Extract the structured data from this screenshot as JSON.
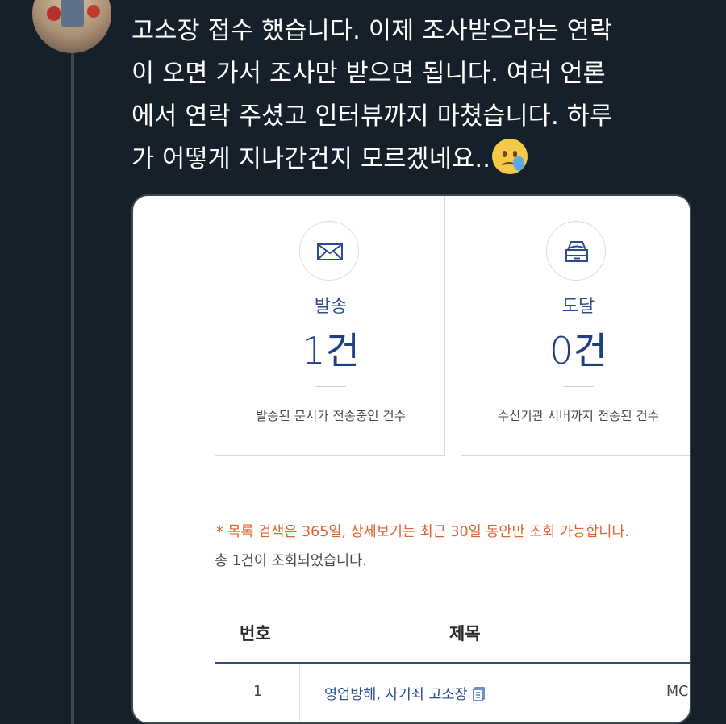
{
  "tweet": {
    "lines": [
      "고소장 접수 했습니다. 이제 조사받으라는 연락",
      "이 오면 가서 조사만 받으면 됩니다. 여러 언론",
      "에서 연락 주셨고 인터뷰까지 마쳤습니다. 하루",
      "가 어떻게 지나간건지 모르겠네요.."
    ],
    "emoji": "crying-face-emoji"
  },
  "screenshot": {
    "cards": [
      {
        "label": "발송",
        "count": "1건",
        "desc": "발송된 문서가 전송중인 건수",
        "icon": "envelope-icon"
      },
      {
        "label": "도달",
        "count": "0건",
        "desc": "수신기관 서버까지 전송된 건수",
        "icon": "inbox-icon"
      }
    ],
    "notice": "* 목록 검색은 365일, 상세보기는 최근 30일 동안만 조회 가능합니다.",
    "total": "총 1건이 조회되었습니다.",
    "table": {
      "headers": [
        "번호",
        "제목"
      ],
      "rows": [
        {
          "no": "1",
          "title": "영업방해, 사기죄 고소장",
          "code": "MC"
        }
      ]
    }
  },
  "colors": {
    "background": "#15202b",
    "accent_blue": "#2b4d8e",
    "notice_orange": "#e0632f"
  }
}
